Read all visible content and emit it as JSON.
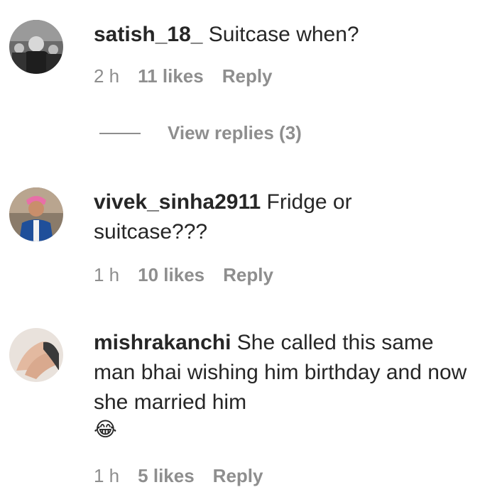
{
  "comments": [
    {
      "username": "satish_18_",
      "text": "Suitcase when?",
      "time": "2 h",
      "likes": "11 likes",
      "reply": "Reply",
      "view_replies": "View replies (3)"
    },
    {
      "username": "vivek_sinha2911",
      "text": "Fridge or suitcase???",
      "time": "1 h",
      "likes": "10 likes",
      "reply": "Reply"
    },
    {
      "username": "mishrakanchi",
      "text": "She called this same man bhai wishing him birthday and now she married him",
      "emoji": "😂",
      "time": "1 h",
      "likes": "5 likes",
      "reply": "Reply"
    }
  ]
}
